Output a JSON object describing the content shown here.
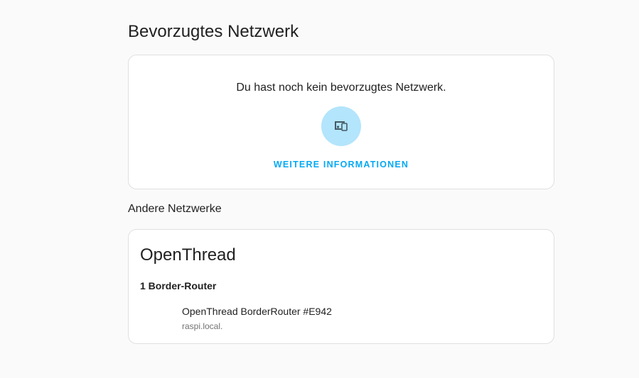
{
  "preferred": {
    "title": "Bevorzugtes Netzwerk",
    "empty_text": "Du hast noch kein bevorzugtes Netzwerk.",
    "icon": "devices-icon",
    "more_info_label": "WEITERE INFORMATIONEN"
  },
  "other": {
    "title": "Andere Netzwerke",
    "networks": [
      {
        "name": "OpenThread",
        "router_count_label": "1 Border-Router",
        "routers": [
          {
            "name": "OpenThread BorderRouter #E942",
            "host": "raspi.local."
          }
        ]
      }
    ]
  },
  "colors": {
    "accent": "#03a9f4",
    "icon_bg": "#b3e5fc",
    "icon_fg": "#455a64",
    "background": "#fafafa",
    "card_border": "#e0e0e0"
  }
}
